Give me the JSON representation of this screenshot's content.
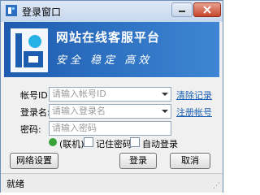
{
  "window": {
    "title": "登录窗口"
  },
  "banner": {
    "title": "网站在线客服平台",
    "subtitle": "安全 稳定 高效"
  },
  "form": {
    "account_label": "帐号ID:",
    "account_placeholder": "请输入帐号ID",
    "username_label": "登录名:",
    "username_placeholder": "请输入登录名",
    "password_label": "密码:",
    "password_placeholder": "请输入密码",
    "clear_link": "清除记录",
    "register_link": "注册帐号",
    "online_label": "(联机)",
    "remember_label": "记住密码",
    "autologin_label": "自动登录"
  },
  "buttons": {
    "network": "网络设置",
    "login": "登录",
    "cancel": "取消"
  },
  "status": {
    "text": "就绪"
  },
  "colors": {
    "banner": "#2a6cc0",
    "link": "#1a5fb4",
    "online": "#3aa23a"
  },
  "icons": [
    "app-icon",
    "logo-icon",
    "minimize-icon",
    "close-icon",
    "online-status-icon",
    "dropdown-arrow-icon",
    "resize-grip-icon"
  ]
}
